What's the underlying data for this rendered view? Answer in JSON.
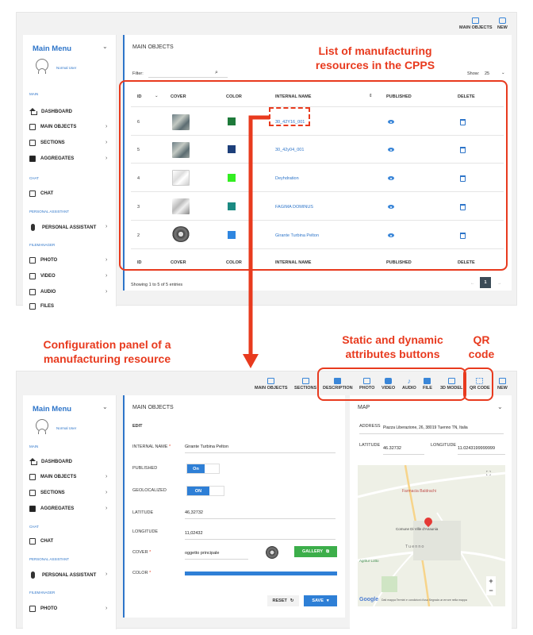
{
  "annotations": {
    "list_caption": "List of manufacturing resources in the CPPS",
    "config_caption": "Configuration panel of a manufacturing resource",
    "attr_caption": "Static and dynamic attributes buttons",
    "qr_caption": "QR code"
  },
  "top": {
    "toolbar": [
      {
        "label": "MAIN OBJECTS",
        "icon": "square-icon"
      },
      {
        "label": "NEW",
        "icon": "chat-icon"
      }
    ],
    "sidebar": {
      "title": "Main Menu",
      "user": "Normal User",
      "sections": {
        "main": "MAIN",
        "chat": "CHAT",
        "assistant": "PERSONAL ASSISTANT",
        "files": "FILEMANAGER"
      },
      "items": {
        "dashboard": "DASHBOARD",
        "main_objects": "MAIN OBJECTS",
        "sections": "SECTIONS",
        "aggregates": "AGGREGATES",
        "chat": "CHAT",
        "personal_assistant": "PERSONAL ASSISTANT",
        "photo": "PHOTO",
        "video": "VIDEO",
        "audio": "AUDIO",
        "files": "FILES"
      }
    },
    "main": {
      "title": "MAIN OBJECTS",
      "filter_label": "Filter:",
      "show_label": "Show:",
      "show_value": "25",
      "columns": [
        "ID",
        "COVER",
        "COLOR",
        "INTERNAL NAME",
        "PUBLISHED",
        "DELETE"
      ],
      "rows": [
        {
          "id": "6",
          "color": "#1e7a3a",
          "name": "30_42Y16_001"
        },
        {
          "id": "5",
          "color": "#1d3f7a",
          "name": "30_42y04_001"
        },
        {
          "id": "4",
          "color": "#33ee22",
          "name": "Deyhdration"
        },
        {
          "id": "3",
          "color": "#1b8a82",
          "name": "FAGIMA DOMINUS"
        },
        {
          "id": "2",
          "color": "#2f86e0",
          "name": "Girante Turbina Pelton"
        }
      ],
      "footer": "Showing 1 to 5 of 5 entries",
      "page": "1"
    }
  },
  "bottom": {
    "toolbar": [
      {
        "label": "MAIN OBJECTS",
        "icon": "square-icon"
      },
      {
        "label": "SECTIONS",
        "icon": "list-icon"
      },
      {
        "label": "DESCRIPTION",
        "icon": "document-icon"
      },
      {
        "label": "PHOTO",
        "icon": "photo-icon"
      },
      {
        "label": "VIDEO",
        "icon": "video-icon"
      },
      {
        "label": "AUDIO",
        "icon": "music-icon"
      },
      {
        "label": "FILE",
        "icon": "file-icon"
      },
      {
        "label": "3D MODEL",
        "icon": "cube-icon"
      },
      {
        "label": "QR CODE",
        "icon": "qr-icon"
      },
      {
        "label": "NEW",
        "icon": "chat-icon"
      }
    ],
    "sidebar": {
      "title": "Main Menu",
      "user": "Normal User",
      "sections": {
        "main": "MAIN",
        "chat": "CHAT",
        "assistant": "PERSONAL ASSISTANT",
        "files": "FILEMANAGER"
      },
      "items": {
        "dashboard": "DASHBOARD",
        "main_objects": "MAIN OBJECTS",
        "sections": "SECTIONS",
        "aggregates": "AGGREGATES",
        "chat": "CHAT",
        "personal_assistant": "PERSONAL ASSISTANT",
        "photo": "PHOTO"
      }
    },
    "edit": {
      "title": "MAIN OBJECTS",
      "subtitle": "EDIT",
      "internal_name_label": "INTERNAL NAME",
      "internal_name_value": "Girante Turbina Pelton",
      "published_label": "PUBLISHED",
      "published_value": "On",
      "geolocalized_label": "GEOLOCALIZED",
      "geolocalized_value": "ON",
      "latitude_label": "LATITUDE",
      "latitude_value": "46,32732",
      "longitude_label": "LONGITUDE",
      "longitude_value": "11,02432",
      "cover_label": "COVER",
      "cover_value": "oggetto principale",
      "gallery_label": "GALLERY",
      "color_label": "COLOR",
      "color_value": "#2f7fd6",
      "reset_label": "RESET",
      "save_label": "SAVE"
    },
    "map": {
      "title": "MAP",
      "address_label": "ADDRESS",
      "address_value": "Piazza Liberazione, 26, 38019 Tuenno TN, Italia",
      "latitude_label": "LATITUDE",
      "latitude_value": "46.32732",
      "longitude_label": "LONGITUDE",
      "longitude_value": "11.0243199999999",
      "place_1": "Farmacia Baldrachi",
      "place_2": "Comune Di Ville d'Anaunia",
      "place_3": "Tuenno",
      "place_4": "Agritur Lotto",
      "google": "Google",
      "map_footer": "Dati mappa   Termini e condizioni d'uso   Segnala un errore nella mappa"
    }
  }
}
